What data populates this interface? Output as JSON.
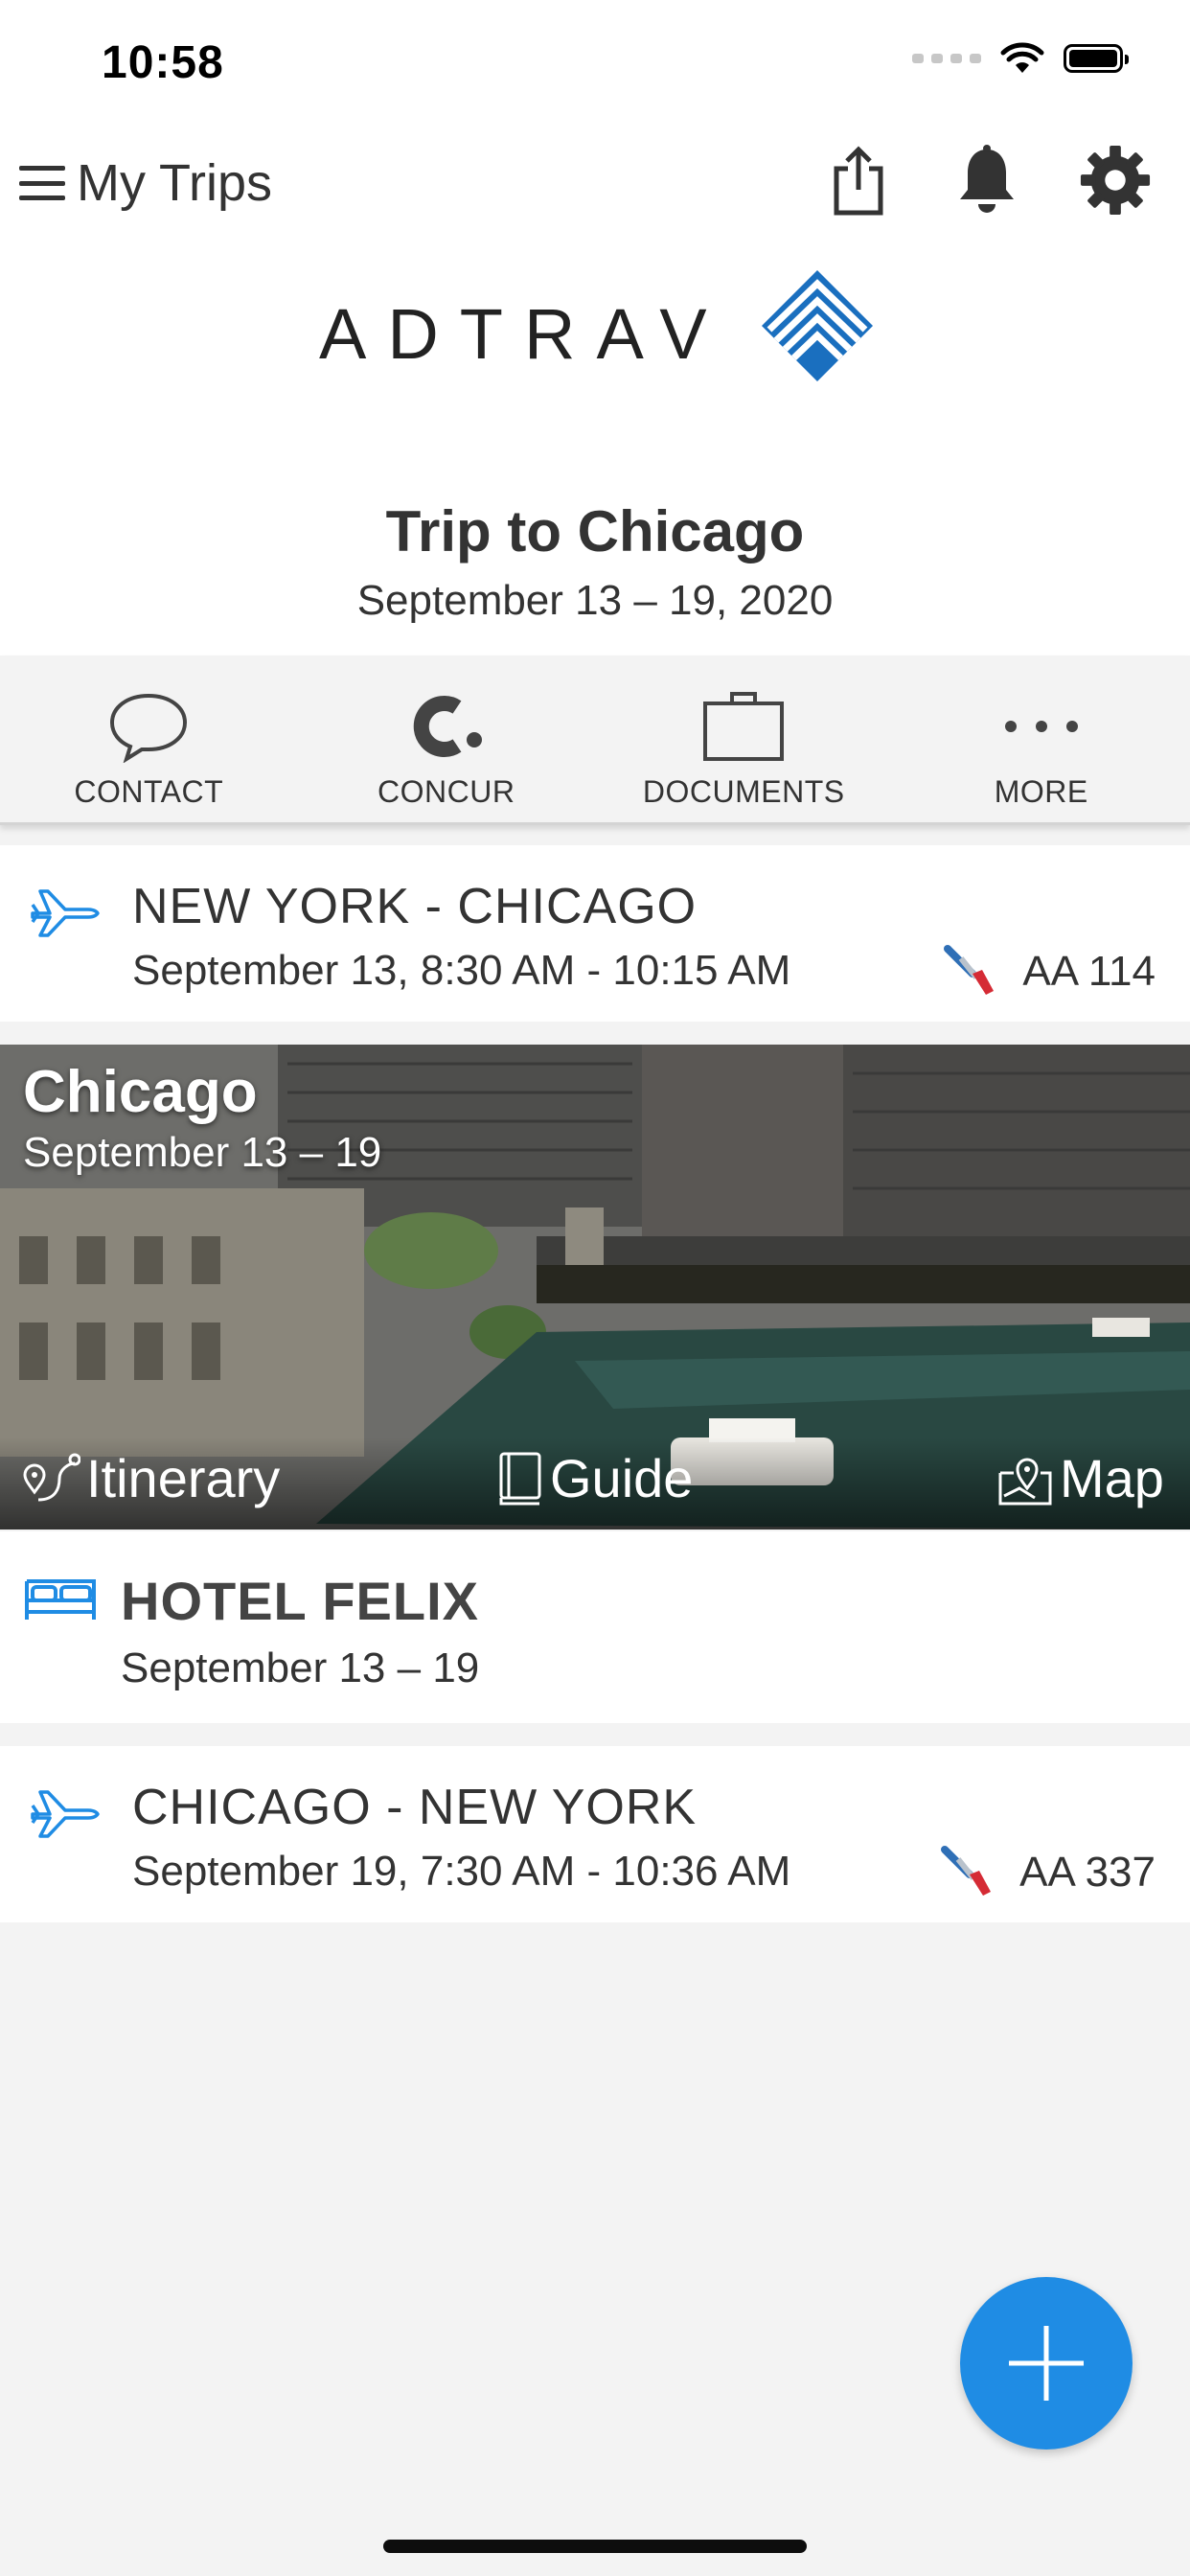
{
  "status_bar": {
    "time": "10:58"
  },
  "nav": {
    "title": "My Trips",
    "icons": [
      "share-icon",
      "bell-icon",
      "gear-icon"
    ]
  },
  "logo": {
    "text": "ADTRAV"
  },
  "trip": {
    "title": "Trip to Chicago",
    "dates": "September 13 – 19, 2020"
  },
  "actions": [
    {
      "label": "CONTACT",
      "icon": "chat-bubble-icon"
    },
    {
      "label": "CONCUR",
      "icon": "concur-icon"
    },
    {
      "label": "DOCUMENTS",
      "icon": "briefcase-icon"
    },
    {
      "label": "MORE",
      "icon": "more-dots-icon"
    }
  ],
  "segments": {
    "flight_out": {
      "route": "NEW YORK - CHICAGO",
      "time": "September 13, 8:30 AM - 10:15 AM",
      "flight": "AA 114"
    },
    "city": {
      "name": "Chicago",
      "dates": "September 13 – 19",
      "links": {
        "itinerary": "Itinerary",
        "guide": "Guide",
        "map": "Map"
      }
    },
    "hotel": {
      "name": "HOTEL FELIX",
      "dates": "September 13 – 19"
    },
    "flight_back": {
      "route": "CHICAGO - NEW YORK",
      "time": "September 19, 7:30 AM - 10:36 AM",
      "flight": "AA 337"
    }
  },
  "colors": {
    "accent": "#1f8ce4",
    "brand_blue": "#1a6fbf",
    "background": "#f3f3f3"
  }
}
